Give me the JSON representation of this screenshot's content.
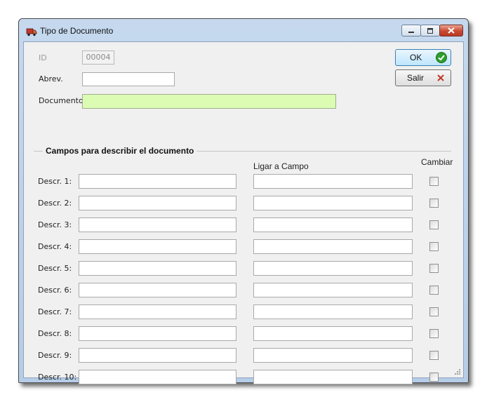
{
  "window": {
    "title": "Tipo de Documento",
    "icon": "truck-icon"
  },
  "fields": {
    "id_label": "ID",
    "id_value": "00004",
    "abrev_label": "Abrev.",
    "abrev_value": "",
    "documento_label": "Documento",
    "documento_value": ""
  },
  "buttons": {
    "ok_label": "OK",
    "salir_label": "Salir"
  },
  "group": {
    "title": "Campos para describir el documento",
    "col_ligar": "Ligar a Campo",
    "col_cambiar": "Cambiar",
    "rows": [
      {
        "label": "Descr. 1:",
        "descr": "",
        "ligar": "",
        "cambiar": false
      },
      {
        "label": "Descr. 2:",
        "descr": "",
        "ligar": "",
        "cambiar": false
      },
      {
        "label": "Descr. 3:",
        "descr": "",
        "ligar": "",
        "cambiar": false
      },
      {
        "label": "Descr. 4:",
        "descr": "",
        "ligar": "",
        "cambiar": false
      },
      {
        "label": "Descr. 5:",
        "descr": "",
        "ligar": "",
        "cambiar": false
      },
      {
        "label": "Descr. 6:",
        "descr": "",
        "ligar": "",
        "cambiar": false
      },
      {
        "label": "Descr. 7:",
        "descr": "",
        "ligar": "",
        "cambiar": false
      },
      {
        "label": "Descr. 8:",
        "descr": "",
        "ligar": "",
        "cambiar": false
      },
      {
        "label": "Descr. 9:",
        "descr": "",
        "ligar": "",
        "cambiar": false
      },
      {
        "label": "Descr. 10:",
        "descr": "",
        "ligar": "",
        "cambiar": false
      }
    ]
  },
  "colors": {
    "documento_bg": "#dcfbb3",
    "ok_icon": "#2e9e2e",
    "salir_icon": "#c0392b",
    "close_button": "#c94a32"
  }
}
